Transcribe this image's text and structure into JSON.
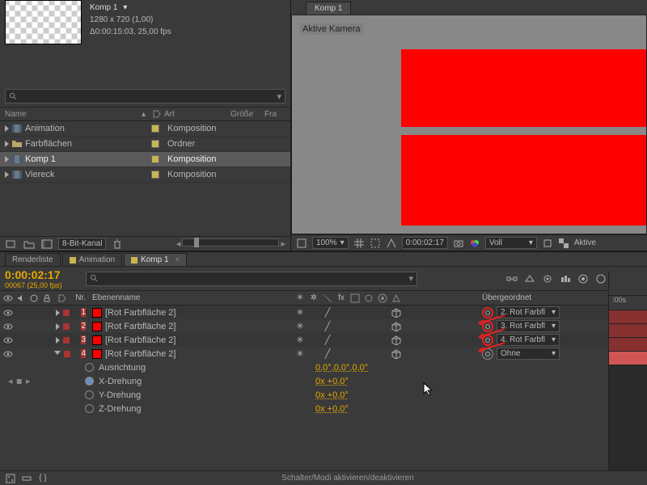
{
  "comp": {
    "title": "Komp 1",
    "dims": "1280 x 720 (1,00)",
    "dur": "Δ0:00:15:03, 25,00 fps"
  },
  "project": {
    "headers": {
      "name": "Name",
      "art": "Art",
      "groesse": "Größe",
      "fr": "Fra"
    },
    "rows": [
      {
        "name": "Animation",
        "art": "Komposition",
        "tag": "#c9b553",
        "kind": "comp"
      },
      {
        "name": "Farbflächen",
        "art": "Ordner",
        "tag": "#c9b553",
        "kind": "folder"
      },
      {
        "name": "Komp 1",
        "art": "Komposition",
        "tag": "#c9b553",
        "kind": "comp",
        "selected": true
      },
      {
        "name": "Viereck",
        "art": "Komposition",
        "tag": "#c9b553",
        "kind": "comp"
      }
    ],
    "depth": "8-Bit-Kanal"
  },
  "viewer": {
    "tab": "Komp 1",
    "camera": "Aktive Kamera",
    "zoom": "100%",
    "time": "0:00:02:17",
    "res": "Voll",
    "aktive": "Aktive"
  },
  "timeline": {
    "tabs": [
      {
        "label": "Renderliste",
        "color": null
      },
      {
        "label": "Animation",
        "color": "#c9b553"
      },
      {
        "label": "Komp 1",
        "color": "#c9b553",
        "active": true,
        "closable": true
      }
    ],
    "timecode": "0:00:02:17",
    "tcsub": "00067 (25,00 fps)",
    "cols": {
      "nr": "Nr.",
      "name": "Ebenenname",
      "parent": "Übergeordnet"
    },
    "layers": [
      {
        "nr": "1",
        "name": "[Rot Farbfläche 2]",
        "parent": "2. Rot Farbfl",
        "whipHL": true
      },
      {
        "nr": "2",
        "name": "[Rot Farbfläche 2]",
        "parent": "3. Rot Farbfl",
        "whipHL": true
      },
      {
        "nr": "3",
        "name": "[Rot Farbfläche 2]",
        "parent": "4. Rot Farbfl",
        "whipHL": true
      },
      {
        "nr": "4",
        "name": "[Rot Farbfläche 2]",
        "parent": "Ohne",
        "whipHL": false
      }
    ],
    "props": [
      {
        "label": "Ausrichtung",
        "value": "0,0°,0,0°,0,0°",
        "key": false,
        "hasNav": false
      },
      {
        "label": "X-Drehung",
        "value": "0x +0,0°",
        "key": true,
        "hasNav": true
      },
      {
        "label": "Y-Drehung",
        "value": "0x +0,0°",
        "key": false,
        "hasNav": false
      },
      {
        "label": "Z-Drehung",
        "value": "0x +0,0°",
        "key": false,
        "hasNav": false
      }
    ],
    "ruler": ":00s",
    "footerCenter": "Schalter/Modi aktivieren/deaktivieren"
  }
}
